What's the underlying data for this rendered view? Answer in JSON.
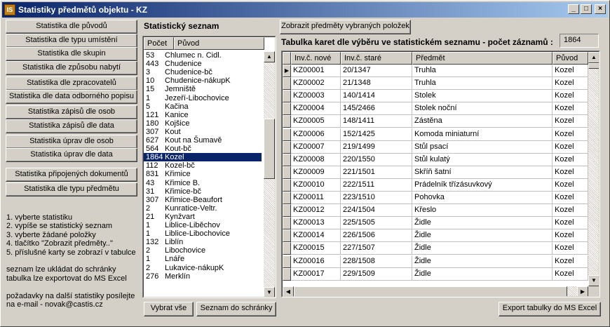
{
  "window": {
    "title": "Statistiky předmětů objektu - KZ",
    "app_icon_text": "IS"
  },
  "titlebar_buttons": [
    "_",
    "□",
    "×"
  ],
  "stat_buttons": [
    "Statistika dle původů",
    "Statistika dle typu umístění",
    "Statistika dle skupin",
    "Statistika dle způsobu nabytí",
    "Statistika dle zpracovatelů",
    "Statistika dle data odborného popisu",
    "Statistika zápisů dle osob",
    "Statistika zápisů dle data",
    "Statistika úprav dle osob",
    "Statistika úprav dle data",
    "Statistika připojených dokumentů",
    "Statistika dle typu předmětu"
  ],
  "instructions": [
    "1. vyberte statistiku",
    "2. vypíše se statistický seznam",
    "3. vyberte žádané položky",
    "4. tlačítko \"Zobrazit předměty..\"",
    "5. příslušné karty se zobrazí v tabulce",
    "",
    "seznam lze ukládat do schránky",
    "tabulka lze exportovat do MS Excel",
    "",
    "požadavky na další statistiky posílejte",
    "na e-mail - novak@castis.cz"
  ],
  "stat_list": {
    "title": "Statistický seznam",
    "col_count": "Počet",
    "col_origin": "Původ",
    "rows": [
      {
        "count": "53",
        "origin": "Chlumec n. Cidl."
      },
      {
        "count": "443",
        "origin": "Chudenice"
      },
      {
        "count": "3",
        "origin": "Chudenice-bč"
      },
      {
        "count": "10",
        "origin": "Chudenice-nákupK"
      },
      {
        "count": "15",
        "origin": "Jemniště"
      },
      {
        "count": "1",
        "origin": "Jezeří-Libochovice"
      },
      {
        "count": "5",
        "origin": "Kačina"
      },
      {
        "count": "121",
        "origin": "Kanice"
      },
      {
        "count": "180",
        "origin": "Kojšice"
      },
      {
        "count": "307",
        "origin": "Kout"
      },
      {
        "count": "627",
        "origin": "Kout na Šumavě"
      },
      {
        "count": "564",
        "origin": "Kout-bč"
      },
      {
        "count": "1864",
        "origin": "Kozel"
      },
      {
        "count": "112",
        "origin": "Kozel-bč"
      },
      {
        "count": "831",
        "origin": "Křimice"
      },
      {
        "count": "43",
        "origin": "Křimice B."
      },
      {
        "count": "31",
        "origin": "Křimice-bč"
      },
      {
        "count": "307",
        "origin": "Křimice-Beaufort"
      },
      {
        "count": "2",
        "origin": "Kunratice-Veltr."
      },
      {
        "count": "21",
        "origin": "Kynžvart"
      },
      {
        "count": "1",
        "origin": "Liblice-Liběchov"
      },
      {
        "count": "1",
        "origin": "Liblice-Libochovice"
      },
      {
        "count": "132",
        "origin": "Liblín"
      },
      {
        "count": "2",
        "origin": "Libochovice"
      },
      {
        "count": "1",
        "origin": "Lnáře"
      },
      {
        "count": "2",
        "origin": "Lukavice-nákupK"
      },
      {
        "count": "276",
        "origin": "Merklín"
      }
    ],
    "selected_index": 12
  },
  "buttons": {
    "select_all": "Vybrat vše",
    "copy_list": "Seznam do schránky",
    "show_items": "Zobrazit předměty vybraných položek",
    "export": "Export tabulky do MS Excel"
  },
  "table": {
    "caption": "Tabulka karet dle výběru ve statistickém seznamu - počet záznamů :",
    "record_count": "1864",
    "columns": [
      "Inv.č. nové",
      "Inv.č. staré",
      "Předmět",
      "Původ"
    ],
    "rows": [
      [
        "KZ00001",
        "20/1347",
        "Truhla",
        "Kozel"
      ],
      [
        "KZ00002",
        "21/1348",
        "Truhla",
        "Kozel"
      ],
      [
        "KZ00003",
        "140/1414",
        "Stolek",
        "Kozel"
      ],
      [
        "KZ00004",
        "145/2466",
        "Stolek noční",
        "Kozel"
      ],
      [
        "KZ00005",
        "148/1411",
        "Zástěna",
        "Kozel"
      ],
      [
        "KZ00006",
        "152/1425",
        "Komoda miniaturní",
        "Kozel"
      ],
      [
        "KZ00007",
        "219/1499",
        "Stůl psací",
        "Kozel"
      ],
      [
        "KZ00008",
        "220/1550",
        "Stůl kulatý",
        "Kozel"
      ],
      [
        "KZ00009",
        "221/1501",
        "Skříň šatní",
        "Kozel"
      ],
      [
        "KZ00010",
        "222/1511",
        "Prádelník třízásuvkový",
        "Kozel"
      ],
      [
        "KZ00011",
        "223/1510",
        "Pohovka",
        "Kozel"
      ],
      [
        "KZ00012",
        "224/1504",
        "Křeslo",
        "Kozel"
      ],
      [
        "KZ00013",
        "225/1505",
        "Židle",
        "Kozel"
      ],
      [
        "KZ00014",
        "226/1506",
        "Židle",
        "Kozel"
      ],
      [
        "KZ00015",
        "227/1507",
        "Židle",
        "Kozel"
      ],
      [
        "KZ00016",
        "228/1508",
        "Židle",
        "Kozel"
      ],
      [
        "KZ00017",
        "229/1509",
        "Židle",
        "Kozel"
      ]
    ],
    "current_row_index": 0
  }
}
